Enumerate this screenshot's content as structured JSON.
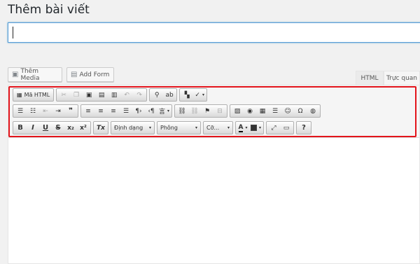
{
  "page": {
    "title": "Thêm bài viết"
  },
  "title_field": {
    "value": "",
    "placeholder": ""
  },
  "media_buttons": {
    "add_media": "Thêm Media",
    "add_form": "Add Form"
  },
  "tabs": {
    "html": "HTML",
    "visual": "Trực quan"
  },
  "toolbar": {
    "source_label": "Mã HTML",
    "format_select": "Định dạng",
    "font_select": "Phông",
    "size_select": "Cỡ...",
    "help": "?",
    "omega": "Ω",
    "bold": "B",
    "italic": "I",
    "underline": "U",
    "strike": "S",
    "subscript": "x₂",
    "superscript": "x²",
    "remove_format": "Tx",
    "text_color": "A",
    "quote": "❞"
  },
  "colors": {
    "highlight_border": "#e3141b",
    "accent": "#5b9dd9"
  }
}
